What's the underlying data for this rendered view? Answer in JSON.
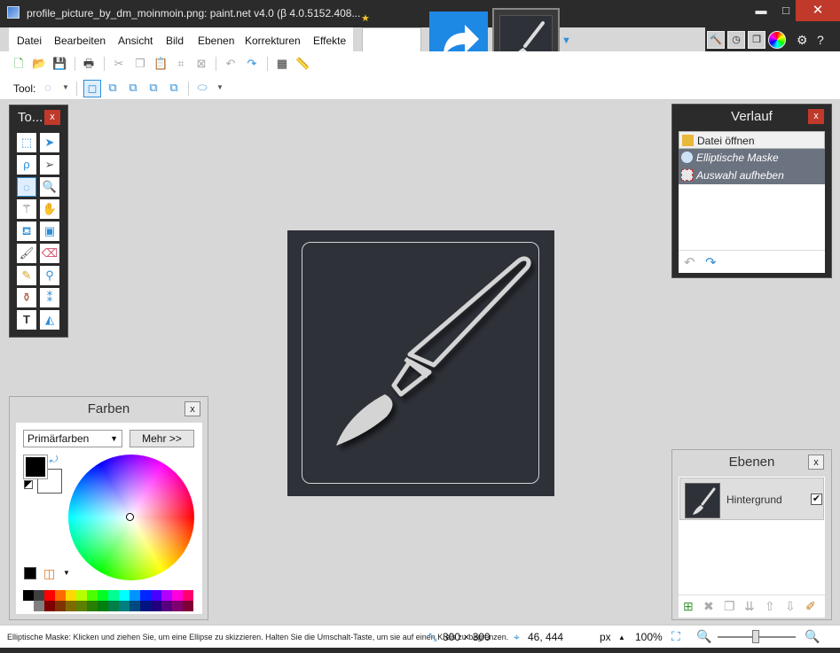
{
  "window": {
    "title": "profile_picture_by_dm_moinmoin.png: paint.net v4.0 (β 4.0.5152.408...",
    "controls": {
      "minimize": "▬",
      "maximize": "□",
      "close": "✕"
    }
  },
  "menu": [
    "Datei",
    "Bearbeiten",
    "Ansicht",
    "Bild",
    "Ebenen",
    "Korrekturen",
    "Effekte"
  ],
  "toolbar2": {
    "tool_label": "Tool:"
  },
  "tools_panel": {
    "title": "To...",
    "close": "x"
  },
  "history_panel": {
    "title": "Verlauf",
    "close": "x",
    "items": [
      {
        "label": "Datei öffnen",
        "state": "current"
      },
      {
        "label": "Elliptische Maske",
        "state": "redo"
      },
      {
        "label": "Auswahl aufheben",
        "state": "redo"
      }
    ]
  },
  "colors_panel": {
    "title": "Farben",
    "close": "x",
    "select_value": "Primärfarben",
    "more_button": "Mehr >>",
    "primary_color": "#000000",
    "secondary_color": "#ffffff"
  },
  "layers_panel": {
    "title": "Ebenen",
    "close": "x",
    "layers": [
      {
        "name": "Hintergrund",
        "visible": true
      }
    ]
  },
  "status": {
    "hint": "Elliptische Maske: Klicken und ziehen Sie, um eine Ellipse zu skizzieren. Halten Sie die Umschalt-Taste, um sie auf einen Kreis zu begrenzen.",
    "image_size": "300 × 300",
    "cursor_pos": "46, 444",
    "unit": "px",
    "zoom": "100%"
  },
  "colors": {
    "accent": "#1e88e5",
    "close_red": "#c0392b",
    "canvas_bg": "#2e3138",
    "workspace": "#d7d7d7"
  }
}
